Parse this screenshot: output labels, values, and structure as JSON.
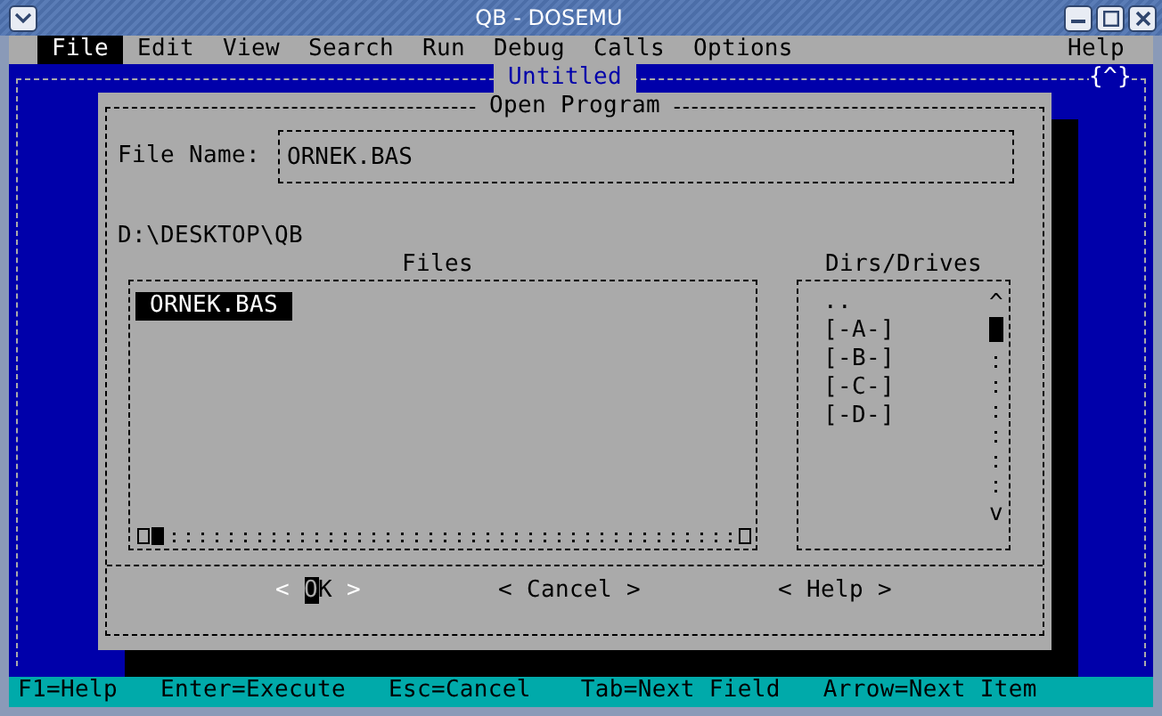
{
  "window": {
    "title": "QB - DOSEMU"
  },
  "menu": {
    "items": [
      {
        "label": "File",
        "selected": true
      },
      {
        "label": "Edit",
        "selected": false
      },
      {
        "label": "View",
        "selected": false
      },
      {
        "label": "Search",
        "selected": false
      },
      {
        "label": "Run",
        "selected": false
      },
      {
        "label": "Debug",
        "selected": false
      },
      {
        "label": "Calls",
        "selected": false
      },
      {
        "label": "Options",
        "selected": false
      }
    ],
    "help": "Help"
  },
  "editor": {
    "title": "Untitled",
    "corner": "{^}"
  },
  "dialog": {
    "title": "Open Program",
    "file_name": {
      "label": "File Name:",
      "value": "ORNEK.BAS"
    },
    "path": "D:\\DESKTOP\\QB",
    "files": {
      "heading": "Files",
      "items": [
        {
          "name": "ORNEK.BAS",
          "selected": true
        }
      ]
    },
    "dirs": {
      "heading": "Dirs/Drives",
      "scroll_up": "^",
      "scroll_down": "v",
      "items": [
        {
          "name": "..",
          "selected": false
        },
        {
          "name": "[-A-]",
          "selected": false
        },
        {
          "name": "[-B-]",
          "selected": false
        },
        {
          "name": "[-C-]",
          "selected": false
        },
        {
          "name": "[-D-]",
          "selected": false
        }
      ]
    },
    "buttons": [
      {
        "open": "<",
        "label": "OK",
        "close": ">",
        "default": true
      },
      {
        "open": "<",
        "label": "Cancel",
        "close": ">",
        "default": false
      },
      {
        "open": "<",
        "label": "Help",
        "close": ">",
        "default": false
      }
    ]
  },
  "status_bar": [
    "F1=Help",
    "Enter=Execute",
    "Esc=Cancel",
    "Tab=Next Field",
    "Arrow=Next Item"
  ]
}
